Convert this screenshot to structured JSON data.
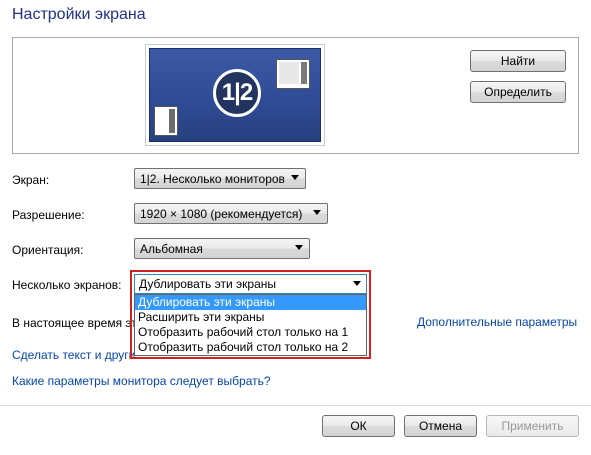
{
  "title": "Настройки экрана",
  "buttons": {
    "find": "Найти",
    "identify": "Определить",
    "ok": "ОК",
    "cancel": "Отмена",
    "apply": "Применить"
  },
  "monitor": {
    "badge": "1|2"
  },
  "settings": {
    "screen_label": "Экран:",
    "screen_value": "1|2. Несколько мониторов",
    "resolution_label": "Разрешение:",
    "resolution_value": "1920 × 1080 (рекомендуется)",
    "orientation_label": "Ориентация:",
    "orientation_value": "Альбомная",
    "multi_label": "Несколько экранов:",
    "multi_value": "Дублировать эти экраны",
    "current_text": "В настоящее время эт"
  },
  "dropdown_options": [
    "Дублировать эти экраны",
    "Расширить эти экраны",
    "Отобразить рабочий стол только на 1",
    "Отобразить рабочий стол только на 2"
  ],
  "links": {
    "advanced": "Дополнительные параметры",
    "text_size": "Сделать текст и други",
    "which_params": "Какие параметры монитора следует выбрать?"
  },
  "colors": {
    "accent_title": "#1e3287",
    "link": "#0645ad",
    "highlight_box": "#d02020",
    "selection": "#3399ff"
  }
}
